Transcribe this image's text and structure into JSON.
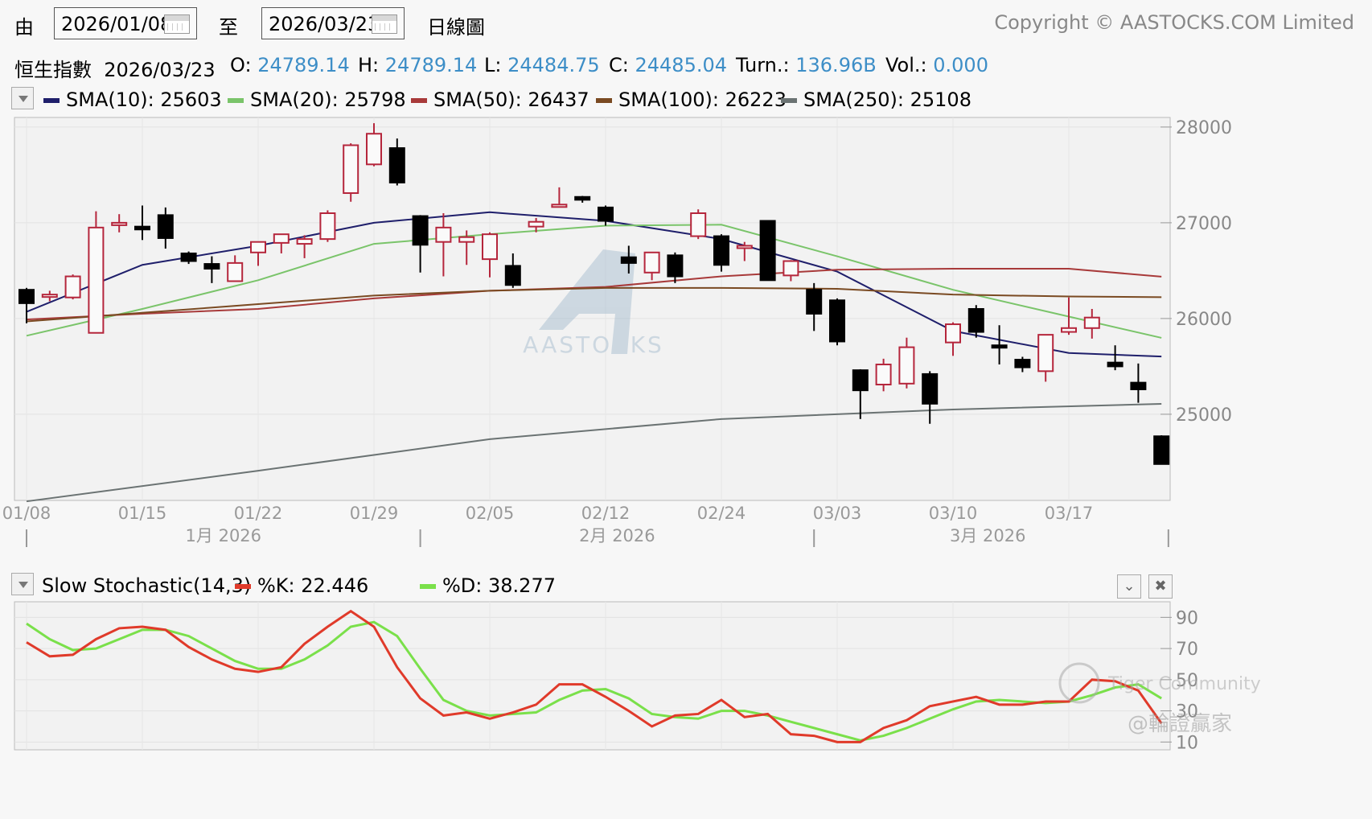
{
  "toolbar": {
    "from_label": "由",
    "from_date": "2026/01/08",
    "to_label": "至",
    "to_date": "2026/03/23",
    "chart_mode": "日線圖",
    "copyright": "Copyright © AASTOCKS.COM Limited"
  },
  "quote": {
    "name": "恒生指數",
    "date": "2026/03/23",
    "open_label": "O:",
    "open": "24789.14",
    "high_label": "H:",
    "high": "24789.14",
    "low_label": "L:",
    "low": "24484.75",
    "close_label": "C:",
    "close": "24485.04",
    "turn_label": "Turn.:",
    "turn": "136.96B",
    "vol_label": "Vol.:",
    "vol": "0.000"
  },
  "sma_legend": [
    {
      "label": "SMA(10): 25603",
      "color": "#1f1f6b"
    },
    {
      "label": "SMA(20): 25798",
      "color": "#7ac46a"
    },
    {
      "label": "SMA(50): 26437",
      "color": "#a83a3a"
    },
    {
      "label": "SMA(100): 26223",
      "color": "#7a4a22"
    },
    {
      "label": "SMA(250): 25108",
      "color": "#6b7373"
    }
  ],
  "stoch_legend": {
    "title": "Slow Stochastic(14,3)",
    "k_label": "%K: 22.446",
    "k_color": "#e03a2a",
    "d_label": "%D: 38.277",
    "d_color": "#7ae04a"
  },
  "watermark": {
    "brand": "AASTOCKS",
    "tiger": "Tiger Community",
    "handle": "@輪證贏家"
  },
  "colors": {
    "up": "#b5263c",
    "down": "#000000",
    "grid": "#d8d8d8"
  },
  "chart_data": [
    {
      "type": "candlestick",
      "ylim": [
        24100,
        28100
      ],
      "y_ticks": [
        25000,
        26000,
        27000,
        28000
      ],
      "x_tick_labels": [
        "01/08",
        "01/15",
        "01/22",
        "01/29",
        "02/05",
        "02/12",
        "02/24",
        "03/03",
        "03/10",
        "03/17"
      ],
      "x_tick_index": [
        0,
        5,
        10,
        15,
        20,
        25,
        30,
        35,
        40,
        45
      ],
      "month_labels": [
        {
          "label": "1月 2026",
          "index": 8.5
        },
        {
          "label": "2月 2026",
          "index": 25.5
        },
        {
          "label": "3月 2026",
          "index": 41.5
        }
      ],
      "dates": [
        "01/08",
        "01/09",
        "01/12",
        "01/13",
        "01/14",
        "01/15",
        "01/16",
        "01/19",
        "01/20",
        "01/21",
        "01/22",
        "01/23",
        "01/26",
        "01/27",
        "01/28",
        "01/29",
        "01/30",
        "02/02",
        "02/03",
        "02/04",
        "02/05",
        "02/06",
        "02/09",
        "02/10",
        "02/11",
        "02/12",
        "02/13",
        "02/16",
        "02/19",
        "02/20",
        "02/24",
        "02/25",
        "02/26",
        "02/27",
        "03/02",
        "03/03",
        "03/04",
        "03/05",
        "03/06",
        "03/09",
        "03/10",
        "03/11",
        "03/12",
        "03/13",
        "03/16",
        "03/17",
        "03/18",
        "03/19",
        "03/20",
        "03/23"
      ],
      "candles": [
        {
          "o": 26300,
          "h": 26320,
          "l": 25950,
          "c": 26160
        },
        {
          "o": 26230,
          "h": 26290,
          "l": 26180,
          "c": 26250
        },
        {
          "o": 26220,
          "h": 26460,
          "l": 26200,
          "c": 26440
        },
        {
          "o": 25850,
          "h": 27120,
          "l": 26750,
          "c": 26950
        },
        {
          "o": 26980,
          "h": 27090,
          "l": 26900,
          "c": 27000
        },
        {
          "o": 26960,
          "h": 27180,
          "l": 26820,
          "c": 26930
        },
        {
          "o": 27080,
          "h": 27160,
          "l": 26730,
          "c": 26840
        },
        {
          "o": 26680,
          "h": 26700,
          "l": 26570,
          "c": 26600
        },
        {
          "o": 26570,
          "h": 26650,
          "l": 26370,
          "c": 26520
        },
        {
          "o": 26390,
          "h": 26660,
          "l": 26390,
          "c": 26580
        },
        {
          "o": 26690,
          "h": 26720,
          "l": 26550,
          "c": 26800
        },
        {
          "o": 26790,
          "h": 26840,
          "l": 26680,
          "c": 26880
        },
        {
          "o": 26780,
          "h": 26870,
          "l": 26630,
          "c": 26830
        },
        {
          "o": 26830,
          "h": 27130,
          "l": 26800,
          "c": 27100
        },
        {
          "o": 27310,
          "h": 27830,
          "l": 27220,
          "c": 27810
        },
        {
          "o": 27610,
          "h": 28040,
          "l": 27590,
          "c": 27930
        },
        {
          "o": 27780,
          "h": 27880,
          "l": 27390,
          "c": 27420
        },
        {
          "o": 27070,
          "h": 27080,
          "l": 26480,
          "c": 26770
        },
        {
          "o": 26800,
          "h": 27100,
          "l": 26440,
          "c": 26950
        },
        {
          "o": 26800,
          "h": 26920,
          "l": 26560,
          "c": 26850
        },
        {
          "o": 26620,
          "h": 26900,
          "l": 26430,
          "c": 26880
        },
        {
          "o": 26550,
          "h": 26680,
          "l": 26320,
          "c": 26350
        },
        {
          "o": 26960,
          "h": 27050,
          "l": 26900,
          "c": 27010
        },
        {
          "o": 27180,
          "h": 27370,
          "l": 27170,
          "c": 27190
        },
        {
          "o": 27270,
          "h": 27280,
          "l": 27210,
          "c": 27240
        },
        {
          "o": 27160,
          "h": 27180,
          "l": 26970,
          "c": 27020
        },
        {
          "o": 26640,
          "h": 26760,
          "l": 26470,
          "c": 26580
        },
        {
          "o": 26480,
          "h": 26690,
          "l": 26400,
          "c": 26690
        },
        {
          "o": 26660,
          "h": 26690,
          "l": 26370,
          "c": 26440
        },
        {
          "o": 26860,
          "h": 27140,
          "l": 26830,
          "c": 27100
        },
        {
          "o": 26860,
          "h": 26880,
          "l": 26490,
          "c": 26560
        },
        {
          "o": 26740,
          "h": 26800,
          "l": 26600,
          "c": 26760
        },
        {
          "o": 27020,
          "h": 27010,
          "l": 26400,
          "c": 26400
        },
        {
          "o": 26450,
          "h": 26610,
          "l": 26390,
          "c": 26600
        },
        {
          "o": 26300,
          "h": 26370,
          "l": 25870,
          "c": 26050
        },
        {
          "o": 26190,
          "h": 26210,
          "l": 25720,
          "c": 25760
        },
        {
          "o": 25460,
          "h": 25470,
          "l": 24950,
          "c": 25250
        },
        {
          "o": 25310,
          "h": 25580,
          "l": 25240,
          "c": 25520
        },
        {
          "o": 25320,
          "h": 25800,
          "l": 25270,
          "c": 25700
        },
        {
          "o": 25420,
          "h": 25450,
          "l": 24900,
          "c": 25110
        },
        {
          "o": 25750,
          "h": 25960,
          "l": 25610,
          "c": 25940
        },
        {
          "o": 26100,
          "h": 26140,
          "l": 25800,
          "c": 25860
        },
        {
          "o": 25720,
          "h": 25930,
          "l": 25520,
          "c": 25710
        },
        {
          "o": 25570,
          "h": 25600,
          "l": 25440,
          "c": 25490
        },
        {
          "o": 25450,
          "h": 25820,
          "l": 25340,
          "c": 25830
        },
        {
          "o": 25860,
          "h": 26220,
          "l": 25830,
          "c": 25900
        },
        {
          "o": 25900,
          "h": 26100,
          "l": 25790,
          "c": 26010
        },
        {
          "o": 25540,
          "h": 25720,
          "l": 25460,
          "c": 25500
        },
        {
          "o": 25330,
          "h": 25530,
          "l": 25120,
          "c": 25260
        },
        {
          "o": 24770,
          "h": 24780,
          "l": 24480,
          "c": 24480
        }
      ],
      "sma": [
        {
          "name": "SMA(10)",
          "color": "#1f1f6b",
          "x_index": [
            0,
            5,
            10,
            15,
            20,
            25,
            30,
            35,
            40,
            45,
            49
          ],
          "values": [
            26070,
            26560,
            26760,
            27000,
            27110,
            27020,
            26830,
            26490,
            25870,
            25640,
            25603
          ]
        },
        {
          "name": "SMA(20)",
          "color": "#7ac46a",
          "x_index": [
            0,
            5,
            10,
            15,
            20,
            25,
            30,
            35,
            40,
            45,
            49
          ],
          "values": [
            25820,
            26100,
            26400,
            26780,
            26880,
            26970,
            26980,
            26650,
            26300,
            26020,
            25798
          ]
        },
        {
          "name": "SMA(50)",
          "color": "#a83a3a",
          "x_index": [
            0,
            5,
            10,
            15,
            20,
            25,
            30,
            35,
            40,
            45,
            49
          ],
          "values": [
            25990,
            26050,
            26100,
            26210,
            26290,
            26330,
            26440,
            26510,
            26520,
            26520,
            26437
          ]
        },
        {
          "name": "SMA(100)",
          "color": "#7a4a22",
          "x_index": [
            0,
            5,
            10,
            15,
            20,
            25,
            30,
            35,
            40,
            45,
            49
          ],
          "values": [
            25970,
            26060,
            26150,
            26240,
            26290,
            26320,
            26320,
            26310,
            26250,
            26230,
            26223
          ]
        },
        {
          "name": "SMA(250)",
          "color": "#6b7373",
          "x_index": [
            0,
            10,
            20,
            30,
            40,
            49
          ],
          "values": [
            24090,
            24410,
            24740,
            24950,
            25050,
            25108
          ]
        }
      ]
    },
    {
      "type": "line",
      "title": "Slow Stochastic(14,3)",
      "ylim": [
        5,
        100
      ],
      "y_ticks": [
        10,
        30,
        50,
        70,
        90
      ],
      "series": [
        {
          "name": "%K",
          "color": "#e03a2a",
          "x_index": [
            0,
            1,
            2,
            3,
            4,
            5,
            6,
            7,
            8,
            9,
            10,
            11,
            12,
            13,
            14,
            15,
            16,
            17,
            18,
            19,
            20,
            21,
            22,
            23,
            24,
            25,
            26,
            27,
            28,
            29,
            30,
            31,
            32,
            33,
            34,
            35,
            36,
            37,
            38,
            39,
            40,
            41,
            42,
            43,
            44,
            45,
            46,
            47,
            48,
            49
          ],
          "values": [
            74,
            65,
            66,
            76,
            83,
            84,
            82,
            71,
            63,
            57,
            55,
            58,
            73,
            84,
            94,
            84,
            58,
            38,
            27,
            29,
            25,
            29,
            34,
            47,
            47,
            39,
            30,
            20,
            27,
            28,
            37,
            26,
            28,
            15,
            14,
            10,
            10,
            19,
            24,
            33,
            36,
            39,
            34,
            34,
            36,
            36,
            50,
            49,
            43,
            22
          ]
        },
        {
          "name": "%D",
          "color": "#7ae04a",
          "x_index": [
            0,
            1,
            2,
            3,
            4,
            5,
            6,
            7,
            8,
            9,
            10,
            11,
            12,
            13,
            14,
            15,
            16,
            17,
            18,
            19,
            20,
            21,
            22,
            23,
            24,
            25,
            26,
            27,
            28,
            29,
            30,
            31,
            32,
            33,
            34,
            35,
            36,
            37,
            38,
            39,
            40,
            41,
            42,
            43,
            44,
            45,
            46,
            47,
            48,
            49
          ],
          "values": [
            86,
            76,
            69,
            70,
            76,
            82,
            82,
            78,
            70,
            62,
            57,
            57,
            63,
            72,
            84,
            87,
            78,
            57,
            37,
            30,
            27,
            28,
            29,
            37,
            43,
            44,
            38,
            28,
            26,
            25,
            30,
            30,
            27,
            23,
            19,
            15,
            11,
            14,
            19,
            25,
            31,
            36,
            37,
            36,
            35,
            36,
            40,
            45,
            47,
            38
          ]
        }
      ]
    }
  ]
}
